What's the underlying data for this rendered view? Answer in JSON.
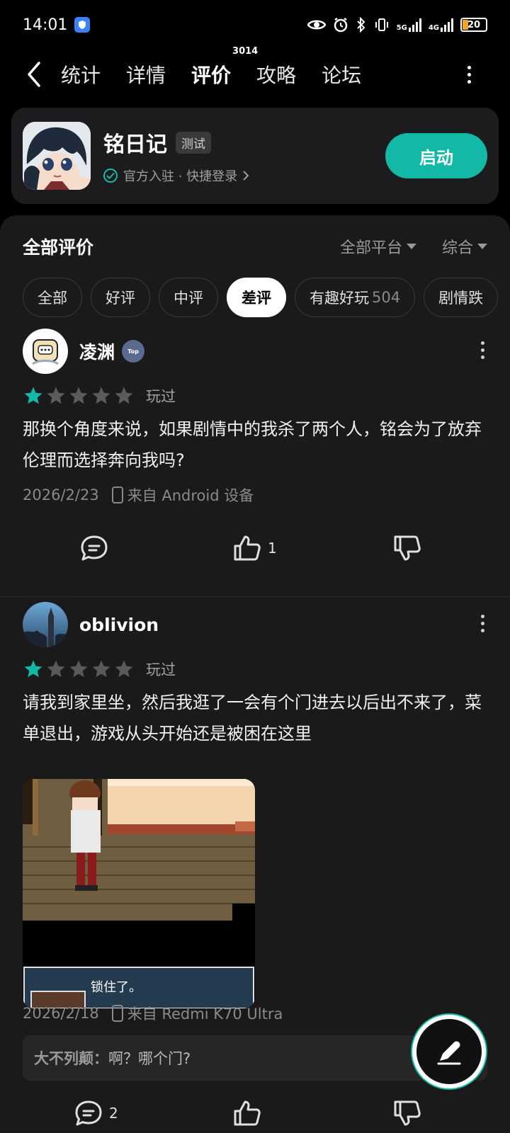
{
  "status": {
    "time": "14:01",
    "net1": "5G",
    "net2": "4G",
    "battery": "20"
  },
  "nav": {
    "tabs": [
      {
        "label": "统计"
      },
      {
        "label": "详情"
      },
      {
        "label": "评价",
        "badge": "3014"
      },
      {
        "label": "攻略"
      },
      {
        "label": "论坛"
      }
    ],
    "active_tab": "评价"
  },
  "game": {
    "title": "铭日记",
    "tag": "测试",
    "subtitle": "官方入驻 · 快捷登录",
    "launch_label": "启动"
  },
  "reviews_header": {
    "title": "全部评价",
    "platform_label": "全部平台",
    "sort_label": "综合"
  },
  "filters": [
    {
      "label": "全部"
    },
    {
      "label": "好评"
    },
    {
      "label": "中评"
    },
    {
      "label": "差评",
      "active": true
    },
    {
      "label": "有趣好玩",
      "count": "504"
    },
    {
      "label": "剧情跌"
    }
  ],
  "reviews": [
    {
      "user": "凌渊",
      "badge": "Top",
      "rating": 1,
      "status": "玩过",
      "text": "那换个角度来说，如果剧情中的我杀了两个人，铭会为了放弃伦理而选择奔向我吗?",
      "date": "2026/2/23",
      "device": "来自 Android 设备",
      "likes": "1"
    },
    {
      "user": "oblivion",
      "rating": 1,
      "status": "玩过",
      "text": "请我到家里坐，然后我逛了一会有个门进去以后出不来了，菜单退出，游戏从头开始还是被困在这里",
      "image_caption": "锁住了。",
      "date": "2026/2/18",
      "device": "来自 Redmi K70 Ultra",
      "reply_author": "大不列颠",
      "reply_text": "啊？哪个门?",
      "comments": "2"
    }
  ],
  "colors": {
    "accent": "#14b8a6",
    "star_on": "#14b8a6",
    "star_off": "#5a5a5a",
    "background": "#1a1a1a"
  }
}
